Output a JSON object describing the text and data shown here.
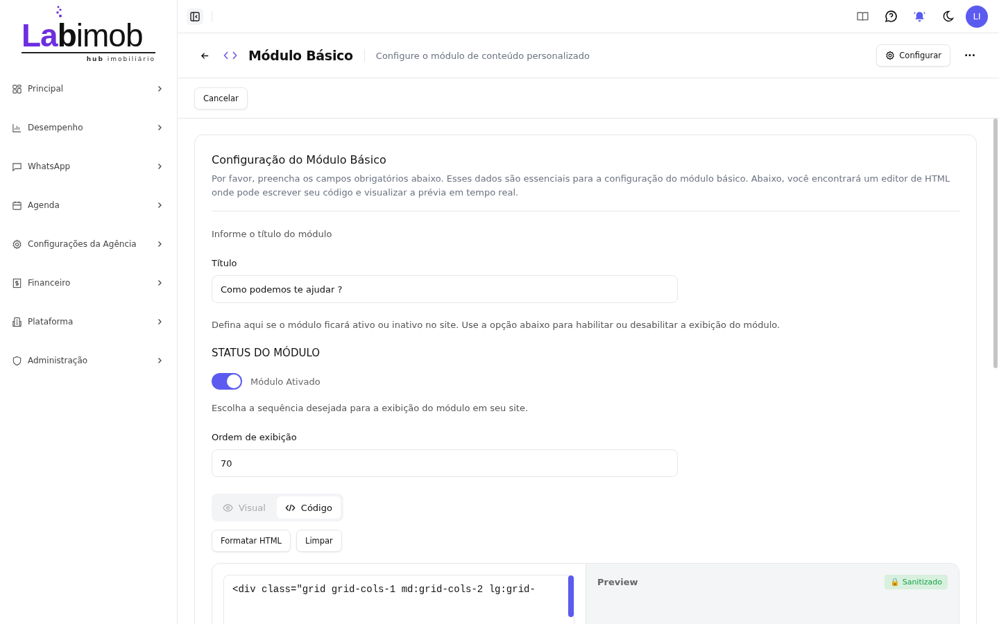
{
  "logo": {
    "accent": "La",
    "bold": "b",
    "light": "imob",
    "tagline_bold": "hub",
    "tagline": "imobiliário"
  },
  "sidebar": {
    "items": [
      {
        "label": "Principal",
        "kind": "grid"
      },
      {
        "label": "Desempenho",
        "kind": "chart"
      },
      {
        "label": "WhatsApp",
        "kind": "chat"
      },
      {
        "label": "Agenda",
        "kind": "calendar"
      },
      {
        "label": "Configurações da Agência",
        "kind": "gear"
      },
      {
        "label": "Financeiro",
        "kind": "money"
      },
      {
        "label": "Plataforma",
        "kind": "building"
      },
      {
        "label": "Administração",
        "kind": "shield"
      }
    ]
  },
  "topbar": {
    "avatar": "LI"
  },
  "header": {
    "title": "Módulo Básico",
    "subtitle": "Configure o módulo de conteúdo personalizado",
    "configure_button": "Configurar",
    "more": "···"
  },
  "toolbar": {
    "cancel_button": "Cancelar"
  },
  "card": {
    "title": "Configuração do Módulo Básico",
    "description": "Por favor, preencha os campos obrigatórios abaixo. Esses dados são essenciais para a configuração do módulo básico. Abaixo, você encontrará um editor de HTML onde pode escrever seu código e visualizar a prévia em tempo real.",
    "title_hint": "Informe o título do módulo",
    "title_label": "Título",
    "title_value": "Como podemos te ajudar ?",
    "status_hint": "Defina aqui se o módulo ficará ativo ou inativo no site. Use a opção abaixo para habilitar ou desabilitar a exibição do módulo.",
    "status_heading": "STATUS DO MÓDULO",
    "toggle": {
      "label": "Módulo Ativado",
      "on": true
    },
    "order_hint": "Escolha a sequência desejada para a exibição do módulo em seu site.",
    "order_label": "Ordem de exibição",
    "order_value": "70",
    "tabs": [
      {
        "label": "Visual",
        "kind": "eye",
        "selected": false
      },
      {
        "label": "Código",
        "kind": "code",
        "selected": true
      }
    ],
    "buttons": [
      "Formatar HTML",
      "Limpar"
    ],
    "code_line": "<div class=\"grid grid-cols-1 md:grid-cols-2 lg:grid-",
    "preview_title": "Preview",
    "preview_badge": "🔒 Sanitizado"
  }
}
